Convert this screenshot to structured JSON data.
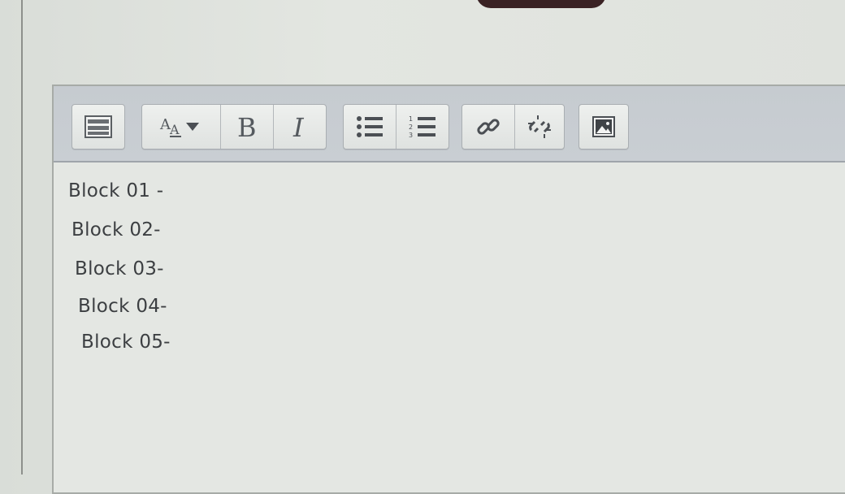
{
  "toolbar": {
    "buttons": [
      {
        "name": "show-more-buttons",
        "icon": "toolbar-toggle-icon"
      },
      {
        "name": "paragraph-styles",
        "icon": "font-style-dropdown-icon"
      },
      {
        "name": "bold",
        "icon": "bold-icon"
      },
      {
        "name": "italic",
        "icon": "italic-icon"
      },
      {
        "name": "unordered-list",
        "icon": "bulleted-list-icon"
      },
      {
        "name": "ordered-list",
        "icon": "numbered-list-icon"
      },
      {
        "name": "link",
        "icon": "link-icon"
      },
      {
        "name": "unlink",
        "icon": "unlink-icon"
      },
      {
        "name": "image",
        "icon": "image-icon"
      }
    ]
  },
  "content": {
    "lines": [
      "Block 01 -",
      "Block 02-",
      "Block 03-",
      "Block 04-",
      "Block 05-"
    ]
  },
  "colors": {
    "toolbar_bg": "#c6cbd0",
    "editor_bg": "#e4e7e3",
    "text": "#3c3f42"
  }
}
